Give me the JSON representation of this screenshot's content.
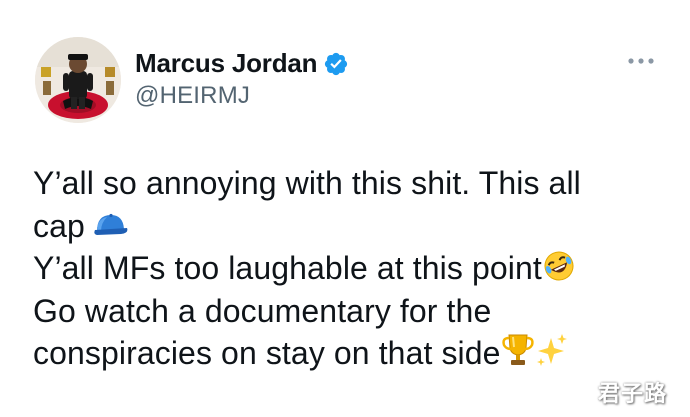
{
  "tweet": {
    "author": {
      "display_name": "Marcus Jordan",
      "handle": "@HEIRMJ",
      "verified": true,
      "avatar_icon": "profile-photo-avatar",
      "verified_icon": "verified-badge-icon"
    },
    "more_icon": "more-options-icon",
    "lines": [
      {
        "text": "Y’all so annoying with this shit. This all",
        "emoji": ""
      },
      {
        "text": "cap",
        "emoji": "blue-cap-emoji"
      },
      {
        "text": "Y’all MFs too laughable at this point",
        "emoji": "rolling-laughing-emoji"
      },
      {
        "text": "Go watch a documentary for the",
        "emoji": ""
      },
      {
        "text": "conspiracies on stay on that side",
        "emoji": "trophy-emoji sparkles-emoji"
      }
    ]
  },
  "watermark": {
    "text": "君子路"
  },
  "colors": {
    "text_primary": "#0f1419",
    "text_secondary": "#536471",
    "verified_blue": "#1d9bf0",
    "background": "#ffffff"
  }
}
